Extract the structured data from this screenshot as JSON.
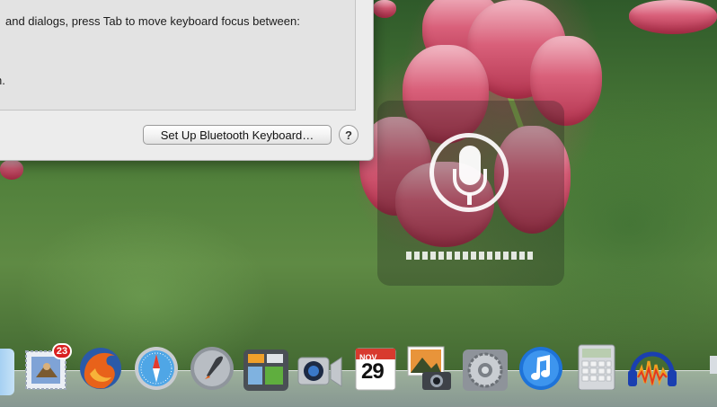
{
  "dialog": {
    "instruction_line": "and dialogs, press Tab to move keyboard focus between:",
    "instruction_fragment": "n.",
    "bluetooth_button": "Set Up Bluetooth Keyboard…",
    "help_button": "?"
  },
  "dictation": {
    "icon": "microphone-icon",
    "level_segments": 16
  },
  "dock": {
    "items": [
      {
        "name": "finder",
        "icon": "finder-icon"
      },
      {
        "name": "mail",
        "icon": "mail-stamp-icon",
        "badge": "23"
      },
      {
        "name": "firefox",
        "icon": "firefox-icon"
      },
      {
        "name": "safari",
        "icon": "compass-icon"
      },
      {
        "name": "launchpad",
        "icon": "rocket-icon"
      },
      {
        "name": "mission-control",
        "icon": "mission-control-icon"
      },
      {
        "name": "facetime",
        "icon": "camera-icon"
      },
      {
        "name": "calendar",
        "icon": "calendar-icon",
        "month": "NOV",
        "day": "29"
      },
      {
        "name": "iphoto",
        "icon": "photo-camera-icon"
      },
      {
        "name": "system-preferences",
        "icon": "gear-icon"
      },
      {
        "name": "itunes",
        "icon": "music-note-icon"
      },
      {
        "name": "calculator",
        "icon": "calculator-icon"
      },
      {
        "name": "audacity",
        "icon": "headphones-waveform-icon"
      }
    ]
  },
  "colors": {
    "badge": "#d92020",
    "itunes_blue": "#1e73d8",
    "firefox_orange": "#e8621a"
  }
}
